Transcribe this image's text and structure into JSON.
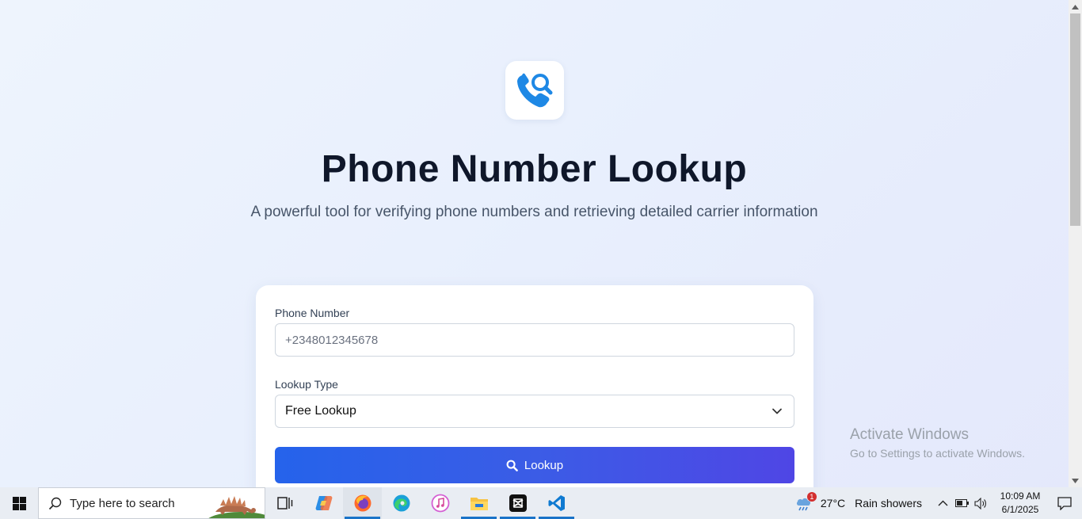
{
  "app": {
    "title": "Phone Number Lookup",
    "subtitle": "A powerful tool for verifying phone numbers and retrieving detailed carrier information",
    "logo_icon": "phone-search-icon"
  },
  "form": {
    "phone_label": "Phone Number",
    "phone_placeholder": "+2348012345678",
    "phone_value": "",
    "lookup_type_label": "Lookup Type",
    "lookup_type_value": "Free Lookup",
    "lookup_button_label": "Lookup"
  },
  "watermark": {
    "line1": "Activate Windows",
    "line2": "Go to Settings to activate Windows."
  },
  "taskbar": {
    "search_placeholder": "Type here to search",
    "pinned": [
      "task-view-icon",
      "copilot-icon",
      "firefox-icon",
      "edge-icon",
      "itunes-icon",
      "file-explorer-icon",
      "capcut-icon",
      "vscode-icon"
    ],
    "weather_temp": "27°C",
    "weather_condition": "Rain showers",
    "weather_badge": "1",
    "time": "10:09 AM",
    "date": "6/1/2025"
  },
  "colors": {
    "accent": "#2563eb",
    "accent_end": "#4f46e5",
    "title": "#0f172a",
    "logo_blue": "#1e88e5"
  }
}
